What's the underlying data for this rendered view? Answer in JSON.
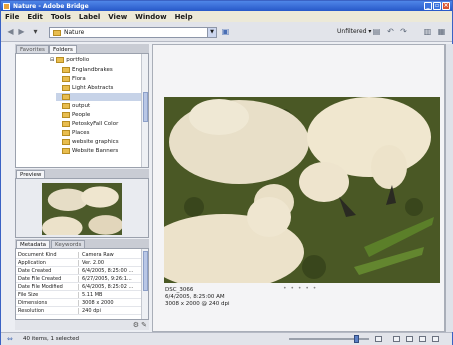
{
  "window": {
    "title": "Nature - Adobe Bridge"
  },
  "menu": [
    "File",
    "Edit",
    "Tools",
    "Label",
    "View",
    "Window",
    "Help"
  ],
  "toolbar": {
    "location": "Nature",
    "filter_label": "Unfiltered ▾"
  },
  "left_tabs": {
    "favorites": "Favorites",
    "folders": "Folders"
  },
  "tree": [
    {
      "label": "portfolio",
      "indent": 0
    },
    {
      "label": "Englandbrakes",
      "indent": 1
    },
    {
      "label": "Flora",
      "indent": 1
    },
    {
      "label": "Light Abstracts",
      "indent": 1
    },
    {
      "label": "",
      "indent": 1,
      "selected": true
    },
    {
      "label": "output",
      "indent": 1
    },
    {
      "label": "People",
      "indent": 1
    },
    {
      "label": "PetoskyFall Color",
      "indent": 1
    },
    {
      "label": "Places",
      "indent": 1
    },
    {
      "label": "website graphics",
      "indent": 1
    },
    {
      "label": "Website Banners",
      "indent": 1
    }
  ],
  "preview_tab": "Preview",
  "meta_tabs": {
    "metadata": "Metadata",
    "keywords": "Keywords"
  },
  "metadata": [
    {
      "key": "Document Kind",
      "value": "Camera Raw"
    },
    {
      "key": "Application",
      "value": "Ver. 2.00"
    },
    {
      "key": "Date Created",
      "value": "6/4/2005, 8:25:00 ..."
    },
    {
      "key": "Date File Created",
      "value": "6/27/2005, 9:26:1..."
    },
    {
      "key": "Date File Modified",
      "value": "6/4/2005, 8:25:02 ..."
    },
    {
      "key": "File Size",
      "value": "5.11 MB"
    },
    {
      "key": "Dimensions",
      "value": "3008 x 2000"
    },
    {
      "key": "Resolution",
      "value": "240 dpi"
    }
  ],
  "caption": {
    "name": "DSC_3066",
    "date": "6/4/2005, 8:25:00 AM",
    "dims": "3008 x 2000 @ 240 dpi"
  },
  "status": {
    "text": "40 items, 1 selected"
  },
  "zoom_level": 0.85
}
